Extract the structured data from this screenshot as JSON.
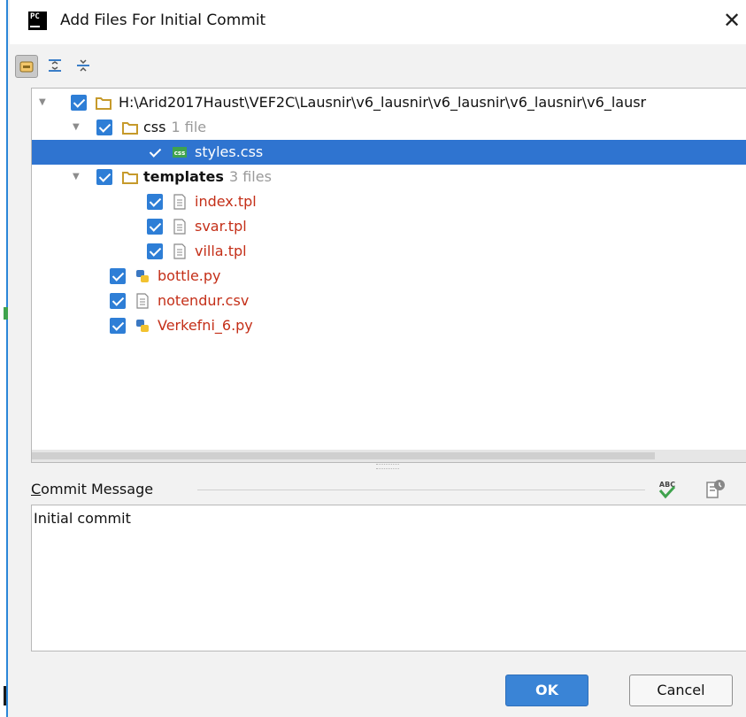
{
  "window": {
    "title": "Add Files For Initial Commit",
    "app_icon_text": "PC",
    "close_glyph": "✕"
  },
  "toolbar": {
    "buttons": [
      {
        "icon": "group-by-directory-icon",
        "active": true
      },
      {
        "icon": "expand-all-icon",
        "active": false
      },
      {
        "icon": "collapse-all-icon",
        "active": false
      }
    ]
  },
  "tree": {
    "root": {
      "label": "H:\\Arid2017Haust\\VEF2C\\Lausnir\\v6_lausnir\\v6_lausnir\\v6_lausnir\\v6_lausr",
      "checked": true,
      "expanded": true
    },
    "css_dir": {
      "label": "css",
      "meta": "1 file",
      "checked": true,
      "expanded": true
    },
    "styles_css": {
      "label": "styles.css",
      "checked": true,
      "selected": true
    },
    "templates_dir": {
      "label": "templates",
      "meta": "3 files",
      "checked": true,
      "expanded": true
    },
    "index_tpl": {
      "label": "index.tpl",
      "checked": true
    },
    "svar_tpl": {
      "label": "svar.tpl",
      "checked": true
    },
    "villa_tpl": {
      "label": "villa.tpl",
      "checked": true
    },
    "bottle_py": {
      "label": "bottle.py",
      "checked": true
    },
    "notendur_csv": {
      "label": "notendur.csv",
      "checked": true
    },
    "verkefni_py": {
      "label": "Verkefni_6.py",
      "checked": true
    }
  },
  "commit": {
    "label_mnemonic": "C",
    "label_rest": "ommit Message",
    "message": "Initial commit",
    "spell_icon_text": "ABC"
  },
  "buttons": {
    "ok": "OK",
    "cancel": "Cancel"
  },
  "colors": {
    "accent": "#2e7ed6",
    "selection": "#2f74d0",
    "unversioned_text": "#c42f18",
    "folder": "#c69a2b"
  }
}
